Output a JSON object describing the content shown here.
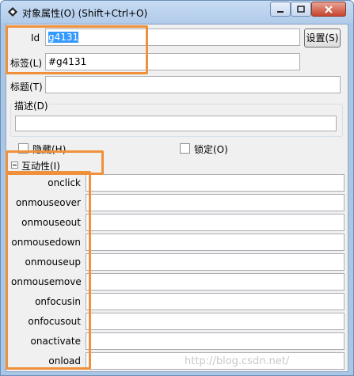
{
  "window": {
    "title": "对象属性(O) (Shift+Ctrl+O)",
    "controls": [
      "minimize",
      "maximize",
      "close"
    ]
  },
  "form": {
    "id_label": "Id",
    "id_value": "g4131",
    "settings_button": "设置(S)",
    "tag_label": "标签(L)",
    "tag_value": "#g4131",
    "title_label": "标题(T)",
    "title_value": "",
    "description_label": "描述(D)",
    "description_value": "",
    "hide_label": "隐藏(H)",
    "lock_label": "锁定(O)"
  },
  "interactivity": {
    "header": "互动性(I)",
    "events": [
      {
        "name": "onclick",
        "value": ""
      },
      {
        "name": "onmouseover",
        "value": ""
      },
      {
        "name": "onmouseout",
        "value": ""
      },
      {
        "name": "onmousedown",
        "value": ""
      },
      {
        "name": "onmouseup",
        "value": ""
      },
      {
        "name": "onmousemove",
        "value": ""
      },
      {
        "name": "onfocusin",
        "value": ""
      },
      {
        "name": "onfocusout",
        "value": ""
      },
      {
        "name": "onactivate",
        "value": ""
      },
      {
        "name": "onload",
        "value": ""
      }
    ]
  },
  "watermark": "http://blog.csdn.net/",
  "colors": {
    "highlight": "#f0903a",
    "selection": "#3399ff"
  }
}
